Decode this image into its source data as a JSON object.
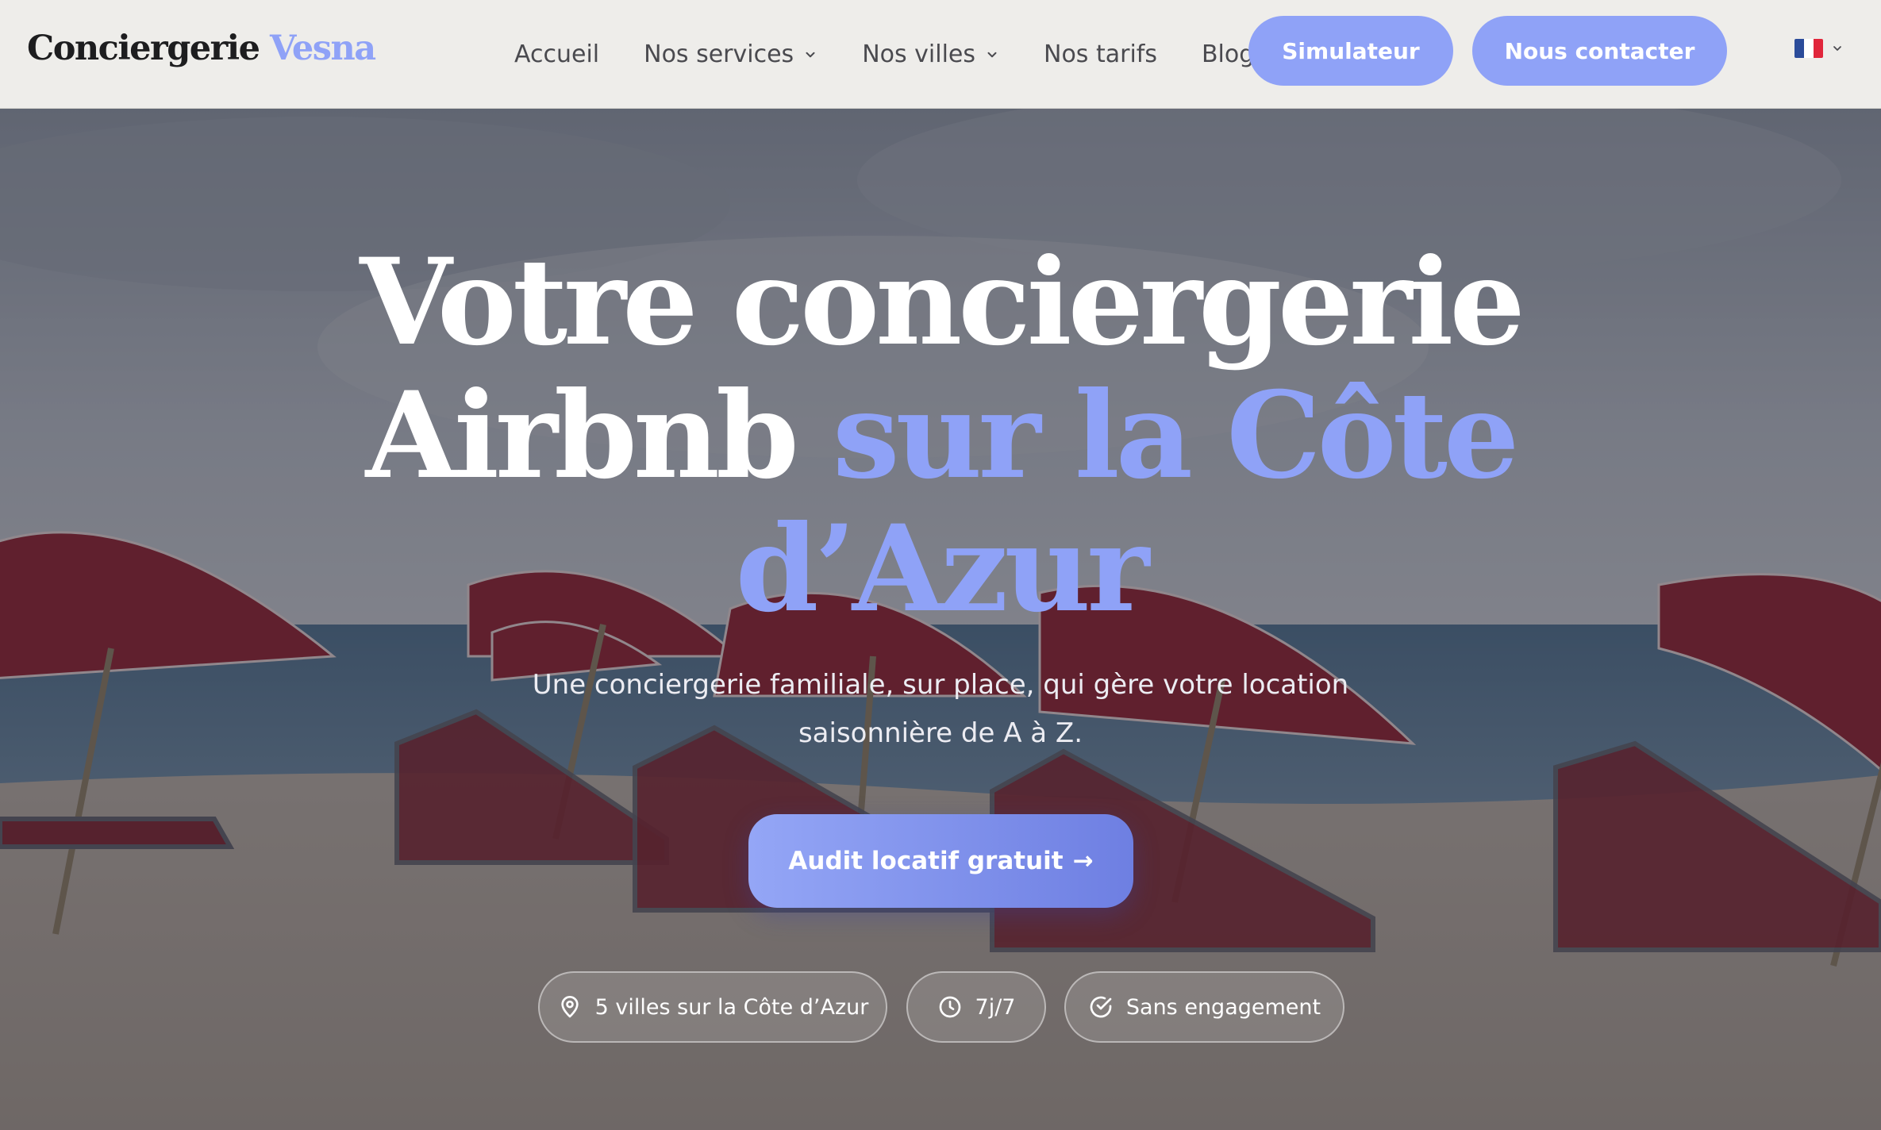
{
  "brand": {
    "name_main": "Conciergerie",
    "name_accent": "Vesna",
    "accent_color": "#8fa2f7"
  },
  "nav": {
    "items": [
      {
        "label": "Accueil",
        "has_dropdown": false
      },
      {
        "label": "Nos services",
        "has_dropdown": true
      },
      {
        "label": "Nos villes",
        "has_dropdown": true
      },
      {
        "label": "Nos tarifs",
        "has_dropdown": false
      },
      {
        "label": "Blog",
        "has_dropdown": false
      }
    ],
    "simulator_button": "Simulateur",
    "contact_button": "Nous contacter",
    "language": {
      "flag": "fr-flag-icon",
      "colors": [
        "#2b4c9a",
        "#ffffff",
        "#e1263b"
      ]
    }
  },
  "hero": {
    "title_line1": "Votre conciergerie",
    "title_line2_plain": "Airbnb",
    "title_line2_accent": "sur la Côte",
    "title_line3_accent": "d’Azur",
    "subtitle": "Une conciergerie familiale, sur place, qui gère votre location saisonnière de A à Z.",
    "cta_label": "Audit locatif gratuit",
    "cta_arrow": "→",
    "badges": [
      {
        "icon": "map-pin-icon",
        "label": "5 villes sur la Côte d’Azur"
      },
      {
        "icon": "clock-icon",
        "label": "7j/7"
      },
      {
        "icon": "check-circle-icon",
        "label": "Sans engagement"
      }
    ],
    "background_image": "beach-with-red-umbrellas-and-loungers"
  }
}
